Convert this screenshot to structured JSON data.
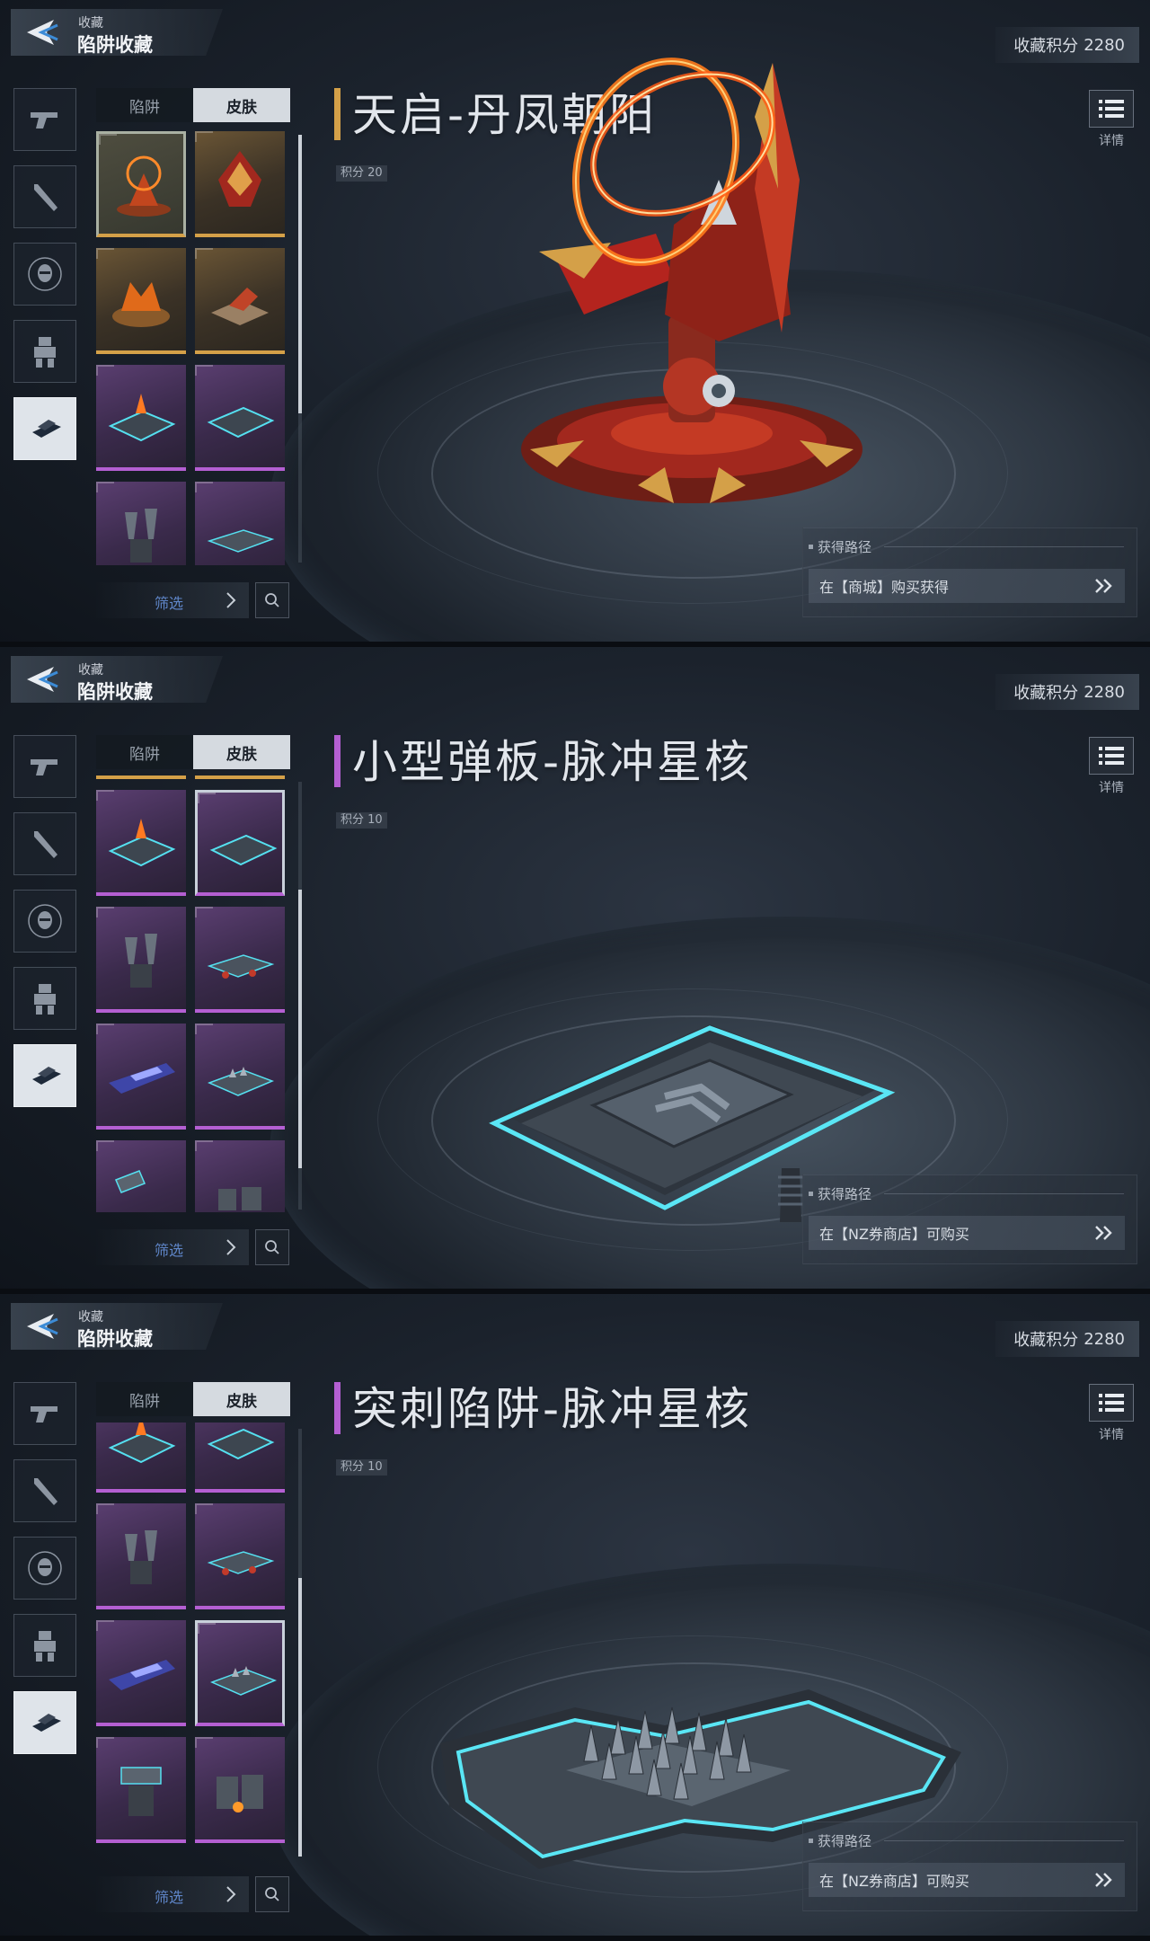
{
  "header": {
    "subtitle": "收藏",
    "title": "陷阱收藏"
  },
  "score": {
    "label": "收藏积分",
    "value": "2280"
  },
  "tabs": {
    "trap": "陷阱",
    "skin": "皮肤"
  },
  "filter": {
    "label": "筛选"
  },
  "detail": {
    "label": "详情"
  },
  "acquisition": {
    "heading": "获得路径"
  },
  "icons": {
    "back": "back-arrow-icon",
    "side": [
      "gun-icon",
      "melee-weapon-icon",
      "character-head-icon",
      "mech-suit-icon",
      "trap-icon"
    ],
    "search": "search-icon",
    "detail": "list-icon",
    "chevron": "double-chevron-right-icon"
  },
  "colors": {
    "gold_rarity": "#d4a048",
    "purple_rarity": "#b45fd2",
    "filter_text": "#5f86c9"
  },
  "screens": [
    {
      "item_name": "天启-丹凤朝阳",
      "rarity": "gold",
      "points": "积分 20",
      "acquire_text": "在【商城】购买获得"
    },
    {
      "item_name": "小型弹板-脉冲星核",
      "rarity": "purple",
      "points": "积分 10",
      "acquire_text": "在【NZ券商店】可购买"
    },
    {
      "item_name": "突刺陷阱-脉冲星核",
      "rarity": "purple",
      "points": "积分 10",
      "acquire_text": "在【NZ券商店】可购买"
    }
  ]
}
